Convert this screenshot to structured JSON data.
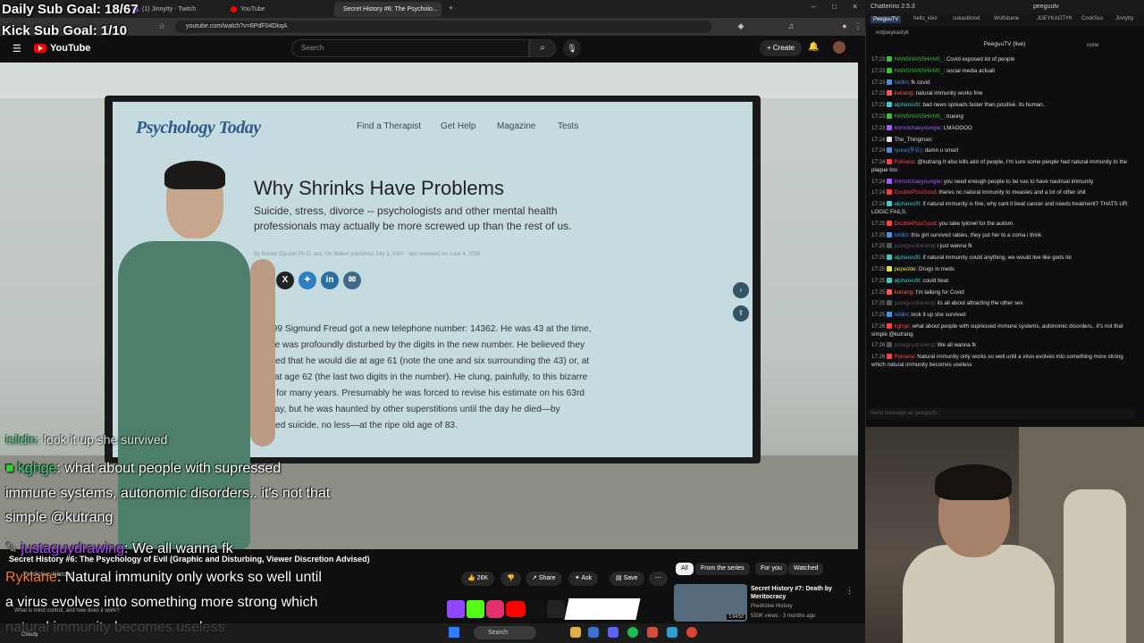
{
  "browser": {
    "tabs": [
      {
        "label": "(1) Jinnytty - Twitch"
      },
      {
        "label": "YouTube"
      },
      {
        "label": "Secret History #6: The Psycholo..."
      }
    ],
    "url": "youtube.com/watch?v=6PdF04DkqA"
  },
  "youtube": {
    "logo": "YouTube",
    "search_placeholder": "Search",
    "create_label": "Create"
  },
  "overlay": {
    "daily_goal": "Daily Sub Goal: 18/67",
    "kick_goal": "Kick Sub Goal: 1/10",
    "chat": [
      {
        "user": "isildin",
        "text": ": look it up she survived"
      },
      {
        "user": "kghge",
        "text": ": what about people with supressed"
      },
      {
        "user": "",
        "text": "immune systems, autonomic disorders.. it's not that"
      },
      {
        "user": "",
        "text": "simple @kutrang"
      },
      {
        "user": "justaguydrawing",
        "text": ": We all wanna fk"
      },
      {
        "user": "Ryklane",
        "text": ": Natural immunity only works so well until"
      },
      {
        "user": "",
        "text": "a virus evolves into something more strong which"
      },
      {
        "user": "",
        "text": "natural immunity becomes useless"
      }
    ]
  },
  "article": {
    "site": "Psychology Today",
    "nav": [
      "Find a Therapist",
      "Get Help",
      "Magazine",
      "Tests"
    ],
    "title": "Why Shrinks Have Problems",
    "subtitle": "Suicide, stress, divorce -- psychologists and other mental health professionals may actually be more screwed up than the rest of us.",
    "byline": "By Robert Epstein Ph.D. and Tim Bower published July 1, 1997 · last reviewed on June 4, 2025",
    "body": "In 1899 Sigmund Freud got a new telephone number: 14362. He was 43 at the time, and he was profoundly disturbed by the digits in the new number. He believed they signified that he would die at age 61 (note the one and six surrounding the 43) or, at best, at age 62 (the last two digits in the number). He clung, painfully, to this bizarre belief for many years. Presumably he was forced to revise his estimate on his 63rd birthday, but he was haunted by other superstitions until the day he died—by assisted suicide, no less—at the ripe old age of 83."
  },
  "video": {
    "title": "Secret History #6: The Psychology of Evil (Graphic and Disturbing, Viewer Discretion Advised)",
    "channel": "Predictive History",
    "desc": "What is mind control, and how does it work?",
    "likes": "26K",
    "share": "Share",
    "ask": "Ask",
    "save": "Save",
    "chips": [
      "All",
      "From the series",
      "For you",
      "Watched"
    ],
    "rec": {
      "title": "Secret History #7: Death by Meritocracy",
      "channel": "Predictive History",
      "meta": "550K views · 3 months ago",
      "duration": "1:04:52"
    }
  },
  "taskbar": {
    "search": "Search",
    "weather": "Cloudy"
  },
  "chatterino": {
    "title": "Chatterino 2.5.3",
    "user": "peeguutv",
    "tabs": [
      "PeeguuTV",
      "hello_kiko",
      "sukasblood",
      "Wolfsbane",
      "JOEYKAOTYK",
      "CookSux",
      "Jinnytty",
      "notjoeykaotyk"
    ],
    "channel": "PeeguuTV (live)",
    "mode": "none",
    "input_placeholder": "Send message as peeguutv...",
    "messages": [
      {
        "time": "17:23",
        "user": "HANSHANSHANS_",
        "color": "#36c236",
        "text": ": Covid exposed lot of people"
      },
      {
        "time": "17:23",
        "user": "HANSHANSHANS_",
        "color": "#36c236",
        "text": ": social media actuall"
      },
      {
        "time": "17:23",
        "user": "isildin",
        "color": "#4a8fe0",
        "text": ": fk covid"
      },
      {
        "time": "17:23",
        "user": "kutrang",
        "color": "#ff5a5a",
        "text": ": natural immunity works fine"
      },
      {
        "time": "17:23",
        "user": "alpharesfit",
        "color": "#3fc8c8",
        "text": ": bad news spreads faster than positive. its human.."
      },
      {
        "time": "17:23",
        "user": "HANSHANSHANS_",
        "color": "#36c236",
        "text": ": trueing"
      },
      {
        "time": "17:23",
        "user": "immotchaeyoungie",
        "color": "#a25bff",
        "text": ": LMAOOOO"
      },
      {
        "time": "17:24",
        "user": "The_Thingman",
        "color": "#dddddd",
        "text": ":"
      },
      {
        "time": "17:24",
        "user": "ryuce(용유)",
        "color": "#4a8fe0",
        "text": ": damn u smart"
      },
      {
        "time": "17:24",
        "user": "Ryklane",
        "color": "#ff4040",
        "text": ": @kutrang It also kills alot of people, I'm sure some people had natural immunity to the plague too"
      },
      {
        "time": "17:24",
        "user": "immotchaeyoungie",
        "color": "#a25bff",
        "text": ": you need enough people to be vax to have nautrual immunity"
      },
      {
        "time": "17:24",
        "user": "DoublePlusGood",
        "color": "#ff4040",
        "text": ": theres no natural immunity to measles and a lot of other shit"
      },
      {
        "time": "17:24",
        "user": "alpharesfit",
        "color": "#3fc8c8",
        "text": ": if natural immunity is fine, why cant it beat cancer and needs treatment? THATS UR LOGIC FAILS."
      },
      {
        "time": "17:25",
        "user": "DoublePlusGood",
        "color": "#ff4040",
        "text": ": you take tylonel for the autism"
      },
      {
        "time": "17:25",
        "user": "isildin",
        "color": "#4a8fe0",
        "text": ": this girl survived rabies. they put her to a coma i think"
      },
      {
        "time": "17:25",
        "user": "justaguydrawing",
        "color": "#555555",
        "text": ": i just wanna fk"
      },
      {
        "time": "17:25",
        "user": "alpharesfit",
        "color": "#3fc8c8",
        "text": ": if natural immunity could anything, we would live like gods lol"
      },
      {
        "time": "17:25",
        "user": "pepedde",
        "color": "#e0e040",
        "text": ": Drugs in meds"
      },
      {
        "time": "17:25",
        "user": "alpharesfit",
        "color": "#3fc8c8",
        "text": ": could beat"
      },
      {
        "time": "17:25",
        "user": "kutrang",
        "color": "#ff5a5a",
        "text": ": I'm talking for Covid"
      },
      {
        "time": "17:25",
        "user": "justaguydrawing",
        "color": "#555555",
        "text": ": its all about attracting the other sex"
      },
      {
        "time": "17:25",
        "user": "isildin",
        "color": "#4a8fe0",
        "text": ": look it up she survived"
      },
      {
        "time": "17:26",
        "user": "kghge",
        "color": "#ff4040",
        "text": ": what about people with supressed immune systems, autonomic disorders.. it's not that simple @kutrang"
      },
      {
        "time": "17:26",
        "user": "justaguydrawing",
        "color": "#555555",
        "text": ": We all wanna fk"
      },
      {
        "time": "17:26",
        "user": "Ryklane",
        "color": "#ff4040",
        "text": ": Natural immunity only works so well until a virus evolves into something more strong which natural immunity becomes useless"
      }
    ]
  }
}
